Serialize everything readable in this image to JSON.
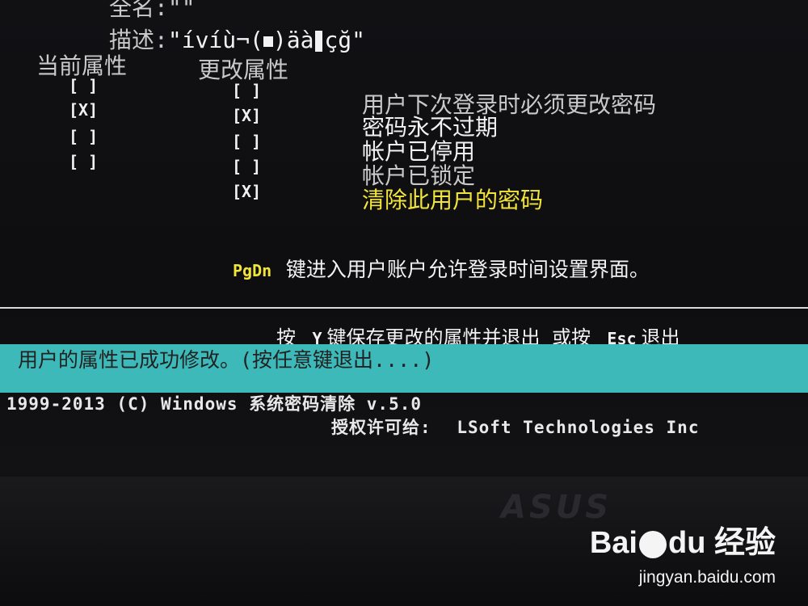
{
  "fullname_label": "全名:\"\"",
  "description_label": "描述:",
  "description_value_pre": "\"ívíù¬(",
  "description_value_mid": ")äà",
  "description_value_post": "çğ\"",
  "current_attr_header": "当前属性",
  "change_attr_header": "更改属性",
  "current_flags": [
    "[ ]",
    "[X]",
    "[ ]",
    "[ ]"
  ],
  "change_flags": [
    "[ ]",
    "[X]",
    "[ ]",
    "[ ]",
    "[X]"
  ],
  "options": [
    "用户下次登录时必须更改密码",
    "密码永不过期",
    "帐户已停用",
    "帐户已锁定",
    "清除此用户的密码"
  ],
  "pgdn_key": "PgDn",
  "pgdn_text": "键进入用户账户允许登录时间设置界面。",
  "save_prompt_pre": "按",
  "save_key": "Y",
  "save_prompt_mid": "键保存更改的属性并退出 或按",
  "esc_key": "Esc",
  "save_prompt_post": "退出",
  "status_message": "用户的属性已成功修改。(按任意键退出....)",
  "copyright": "1999-2013 (C)  Windows 系统密码清除 v.5.0",
  "license_label": "授权许可给:",
  "license_holder": "LSoft Technologies Inc",
  "monitor_brand": "ASUS",
  "watermark_logo_a": "Bai",
  "watermark_logo_b": "du",
  "watermark_logo_c": "经验",
  "watermark_url": "jingyan.baidu.com",
  "colors": {
    "background": "#0e0e10",
    "status_bar": "#3eb9b9",
    "highlight": "#f1e43a"
  }
}
